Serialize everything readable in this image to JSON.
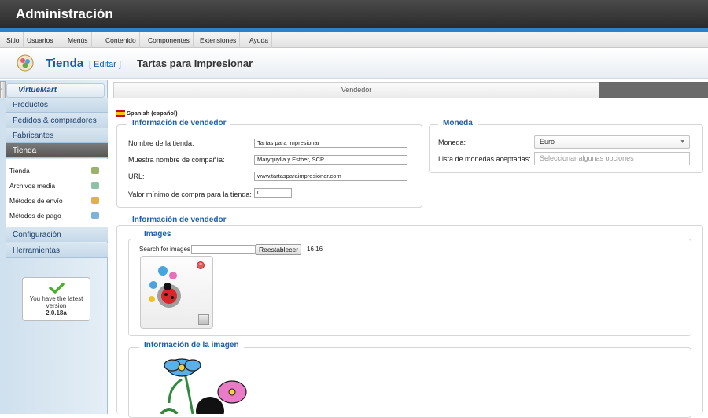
{
  "header": {
    "title": "Administración"
  },
  "menu": [
    "Sitio",
    "Usuarios",
    "Menús",
    "Contenido",
    "Componentes",
    "Extensiones",
    "Ayuda"
  ],
  "page": {
    "title": "Tienda",
    "edit_label": "[ Editar ]",
    "shop_name": "Tartas para Impresionar"
  },
  "sidebar": {
    "logo": "VirtueMart",
    "items": [
      "Productos",
      "Pedidos & compradores",
      "Fabricantes",
      "Tienda"
    ],
    "subitems": [
      "Tienda",
      "Archivos media",
      "Métodos de envío",
      "Métodos de pago"
    ],
    "items2": [
      "Configuración",
      "Herramientas"
    ],
    "version_box": {
      "text": "You have the latest version",
      "version": "2.0.18a"
    }
  },
  "tabs": {
    "active": "Vendedor"
  },
  "language": "Spanish (español)",
  "vendor_info": {
    "legend": "Información de vendedor",
    "store_name_label": "Nombre de la tienda:",
    "store_name": "Tartas para Impresionar",
    "company_label": "Muestra nombre de compañía:",
    "company": "Maryquylla y Esther, SCP",
    "url_label": "URL:",
    "url": "www.tartasparaimpresionar.com",
    "min_label": "Valor mínimo de compra para la tienda:",
    "min_value": "0"
  },
  "currency": {
    "legend": "Moneda",
    "currency_label": "Moneda:",
    "currency_value": "Euro",
    "accepted_label": "Lista de monedas aceptadas:",
    "accepted_placeholder": "Seleccionar algunas opciones"
  },
  "vendor_info2": {
    "legend": "Información de vendedor",
    "images_legend": "Images",
    "search_label": "Search for images",
    "reset_label": "Reestablecer",
    "count": "16 16",
    "image_info_legend": "Información de la imagen"
  },
  "colors": {
    "accent": "#1d5ea8",
    "header_bg": "#2f2f2f",
    "blue_line": "#2b82c9"
  }
}
